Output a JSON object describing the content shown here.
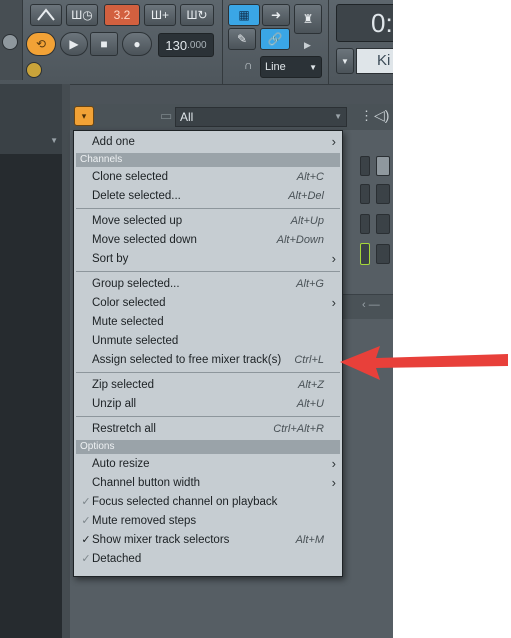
{
  "toolbar": {
    "pattern_display": "3.2",
    "tempo": "130",
    "tempo_decimal": ".000",
    "time_display": "0:",
    "snap_mode": "Line",
    "channel_name_partial": "Ki"
  },
  "rack": {
    "filter_value": "All"
  },
  "menu": {
    "items": [
      {
        "label": "Add one",
        "submenu": true
      },
      {
        "section": "Channels"
      },
      {
        "label": "Clone selected",
        "shortcut": "Alt+C"
      },
      {
        "label": "Delete selected...",
        "shortcut": "Alt+Del"
      },
      {
        "label": "Move selected up",
        "shortcut": "Alt+Up"
      },
      {
        "label": "Move selected down",
        "shortcut": "Alt+Down"
      },
      {
        "label": "Sort by",
        "submenu": true
      },
      {
        "label": "Group selected...",
        "shortcut": "Alt+G"
      },
      {
        "label": "Color selected",
        "submenu": true
      },
      {
        "label": "Mute selected"
      },
      {
        "label": "Unmute selected"
      },
      {
        "label": "Assign selected to free mixer track(s)",
        "shortcut": "Ctrl+L"
      },
      {
        "label": "Zip selected",
        "shortcut": "Alt+Z"
      },
      {
        "label": "Unzip all",
        "shortcut": "Alt+U"
      },
      {
        "label": "Restretch all",
        "shortcut": "Ctrl+Alt+R"
      },
      {
        "section": "Options"
      },
      {
        "label": "Auto resize",
        "submenu": true
      },
      {
        "label": "Channel button width",
        "submenu": true
      },
      {
        "label": "Focus selected channel on playback",
        "check": "dim"
      },
      {
        "label": "Mute removed steps",
        "check": "dim"
      },
      {
        "label": "Show mixer track selectors",
        "shortcut": "Alt+M",
        "check": "on"
      },
      {
        "label": "Detached",
        "check": "dim"
      }
    ]
  },
  "annotation": {
    "arrow_color": "#e8403a"
  }
}
